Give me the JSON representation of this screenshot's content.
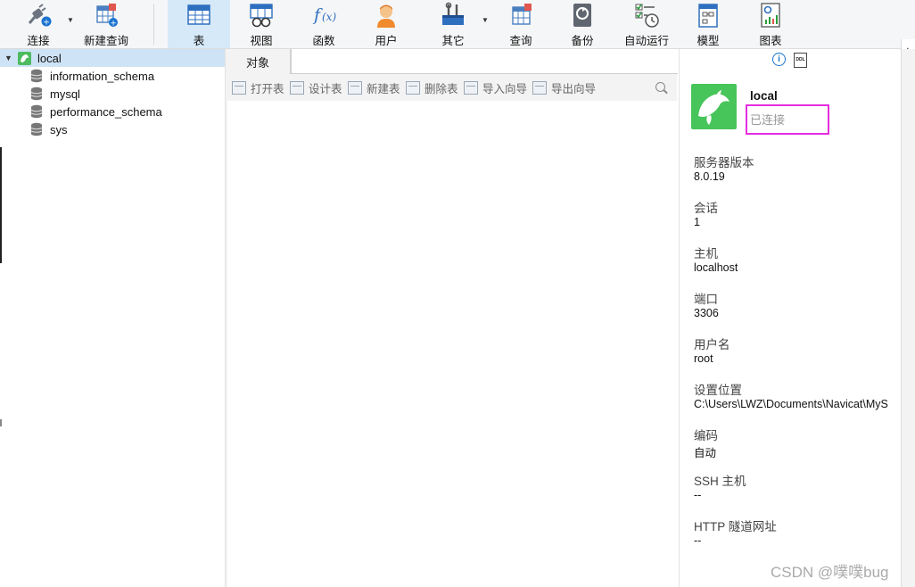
{
  "toolbar": {
    "buttons": [
      {
        "label": "连接",
        "icon": "plug-icon"
      },
      {
        "label": "新建查询",
        "icon": "new-query-icon"
      },
      {
        "label": "表",
        "icon": "table-icon",
        "active": true
      },
      {
        "label": "视图",
        "icon": "view-icon"
      },
      {
        "label": "函数",
        "icon": "function-icon"
      },
      {
        "label": "用户",
        "icon": "user-icon"
      },
      {
        "label": "其它",
        "icon": "tools-icon"
      },
      {
        "label": "查询",
        "icon": "query-icon"
      },
      {
        "label": "备份",
        "icon": "backup-icon"
      },
      {
        "label": "自动运行",
        "icon": "auto-run-icon"
      },
      {
        "label": "模型",
        "icon": "model-icon"
      },
      {
        "label": "图表",
        "icon": "chart-icon"
      }
    ]
  },
  "nav": {
    "connection": "local",
    "databases": [
      "information_schema",
      "mysql",
      "performance_schema",
      "sys"
    ]
  },
  "center": {
    "tab_label": "对象",
    "actions": [
      "打开表",
      "设计表",
      "新建表",
      "删除表",
      "导入向导",
      "导出向导"
    ]
  },
  "info": {
    "name": "local",
    "status": "已连接",
    "fields": [
      {
        "label": "服务器版本",
        "value": "8.0.19"
      },
      {
        "label": "会话",
        "value": "1"
      },
      {
        "label": "主机",
        "value": "localhost"
      },
      {
        "label": "端口",
        "value": "3306"
      },
      {
        "label": "用户名",
        "value": "root"
      },
      {
        "label": "设置位置",
        "value": "C:\\Users\\LWZ\\Documents\\Navicat\\MyS"
      },
      {
        "label": "编码",
        "value": "自动"
      },
      {
        "label": "SSH 主机",
        "value": "--"
      },
      {
        "label": "HTTP 隧道网址",
        "value": "--"
      }
    ]
  },
  "edge": {
    "partial_text": "定文"
  },
  "watermark": "CSDN @噗噗bug",
  "colors": {
    "accent": "#1a73d0",
    "brand_green": "#47c55a",
    "highlight_box": "#e62ce0",
    "selection": "#cfe3f6"
  }
}
